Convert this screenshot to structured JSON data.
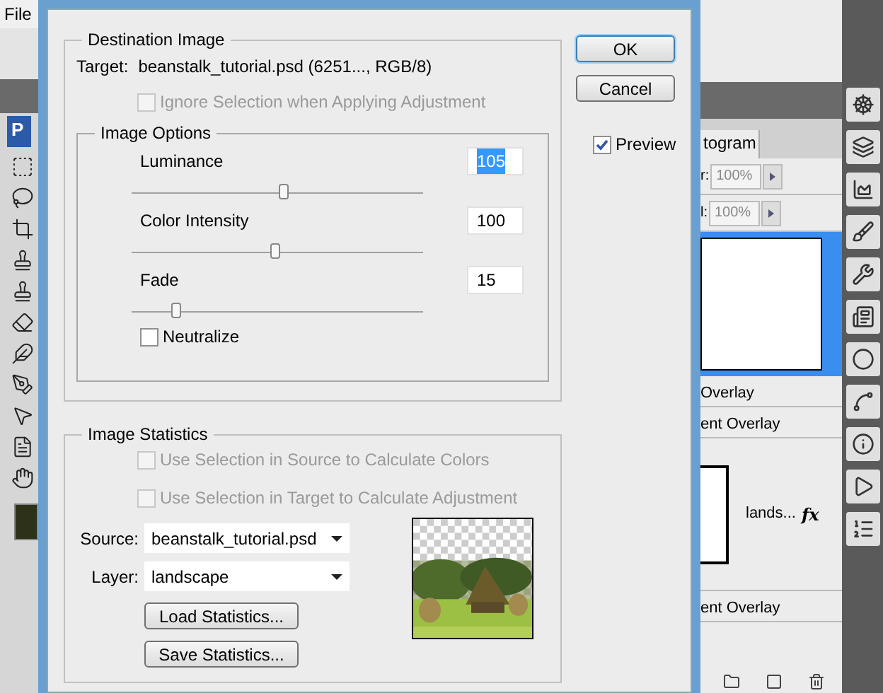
{
  "app": {
    "menu": [
      "File"
    ],
    "logo": "P"
  },
  "dialog": {
    "destination": {
      "title": "Destination Image",
      "target_label": "Target:",
      "target_value": "beanstalk_tutorial.psd (6251..., RGB/8)",
      "ignore_selection": {
        "label": "Ignore Selection when Applying Adjustment",
        "checked": false,
        "disabled": true
      }
    },
    "image_options": {
      "title": "Image Options",
      "sliders": [
        {
          "label": "Luminance",
          "value": "105",
          "level": 0.52,
          "highlighted": true
        },
        {
          "label": "Color Intensity",
          "value": "100",
          "level": 0.49,
          "highlighted": false
        },
        {
          "label": "Fade",
          "value": "15",
          "level": 0.15,
          "highlighted": false
        }
      ],
      "neutralize": {
        "label": "Neutralize",
        "checked": false,
        "disabled": false
      }
    },
    "statistics": {
      "title": "Image Statistics",
      "options": [
        {
          "label": "Use Selection in Source to Calculate Colors",
          "checked": false,
          "disabled": true
        },
        {
          "label": "Use Selection in Target to Calculate Adjustment",
          "checked": false,
          "disabled": true
        }
      ],
      "selects": [
        {
          "label": "Source:",
          "value": "beanstalk_tutorial.psd"
        },
        {
          "label": "Layer:",
          "value": "landscape"
        }
      ],
      "buttons": [
        "Load Statistics...",
        "Save Statistics..."
      ],
      "preview_image": {
        "kind": "picture"
      }
    },
    "buttons": [
      {
        "label": "OK",
        "default": true
      },
      {
        "label": "Cancel",
        "default": false
      }
    ],
    "preview": {
      "label": "Preview",
      "checked": true
    }
  },
  "layers_panel": {
    "tab": "togram",
    "fields": [
      {
        "label": "r:",
        "value": "100%"
      },
      {
        "label": "l:",
        "value": "100%"
      }
    ],
    "rows": [
      {
        "label": "Overlay",
        "fx": false,
        "thumbnail": false
      },
      {
        "label": "ent Overlay",
        "fx": false,
        "thumbnail": false
      },
      {
        "label": "lands...",
        "fx": true,
        "thumbnail": true
      },
      {
        "label": "ent Overlay",
        "fx": false,
        "thumbnail": false
      }
    ],
    "fx_label": "fx"
  }
}
